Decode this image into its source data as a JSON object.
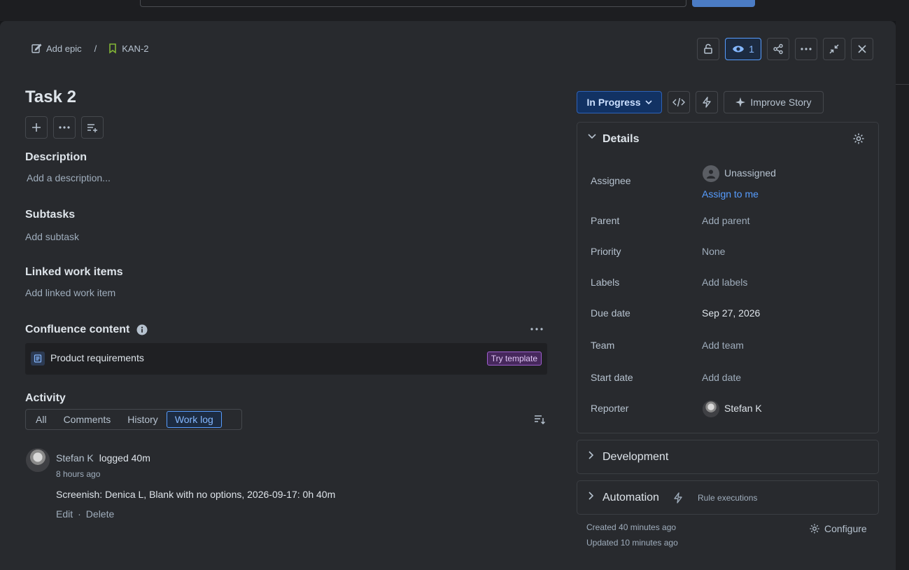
{
  "header": {
    "add_epic": "Add epic",
    "separator": "/",
    "issue_key": "KAN-2",
    "watch_count": "1"
  },
  "issue": {
    "title": "Task 2"
  },
  "description": {
    "heading": "Description",
    "placeholder": "Add a description..."
  },
  "subtasks": {
    "heading": "Subtasks",
    "placeholder": "Add subtask"
  },
  "linked": {
    "heading": "Linked work items",
    "placeholder": "Add linked work item"
  },
  "confluence": {
    "heading": "Confluence content",
    "item_label": "Product requirements",
    "tag": "Try template"
  },
  "activity": {
    "heading": "Activity",
    "tabs": [
      "All",
      "Comments",
      "History",
      "Work log"
    ],
    "active_tab": "Work log",
    "entry": {
      "author": "Stefan K",
      "action": "logged 40m",
      "time": "8 hours ago",
      "text": "Screenish: Denica L, Blank with no options, 2026-09-17: 0h 40m",
      "edit": "Edit",
      "dot": "·",
      "delete": "Delete"
    }
  },
  "toolbar": {
    "status": "In Progress",
    "improve": "Improve Story"
  },
  "details": {
    "heading": "Details",
    "fields": {
      "assignee_label": "Assignee",
      "assignee_value": "Unassigned",
      "assign_to_me": "Assign to me",
      "parent_label": "Parent",
      "parent_value": "Add parent",
      "priority_label": "Priority",
      "priority_value": "None",
      "labels_label": "Labels",
      "labels_value": "Add labels",
      "due_label": "Due date",
      "due_value": "Sep 27, 2026",
      "team_label": "Team",
      "team_value": "Add team",
      "start_label": "Start date",
      "start_value": "Add date",
      "reporter_label": "Reporter",
      "reporter_value": "Stefan K"
    }
  },
  "development": {
    "heading": "Development"
  },
  "automation": {
    "heading": "Automation",
    "rule_executions": "Rule executions"
  },
  "footer": {
    "created": "Created 40 minutes ago",
    "updated": "Updated 10 minutes ago",
    "configure": "Configure"
  },
  "colors": {
    "accent": "#579dff",
    "status_bg": "#123263",
    "tag_purple": "#46285c"
  }
}
